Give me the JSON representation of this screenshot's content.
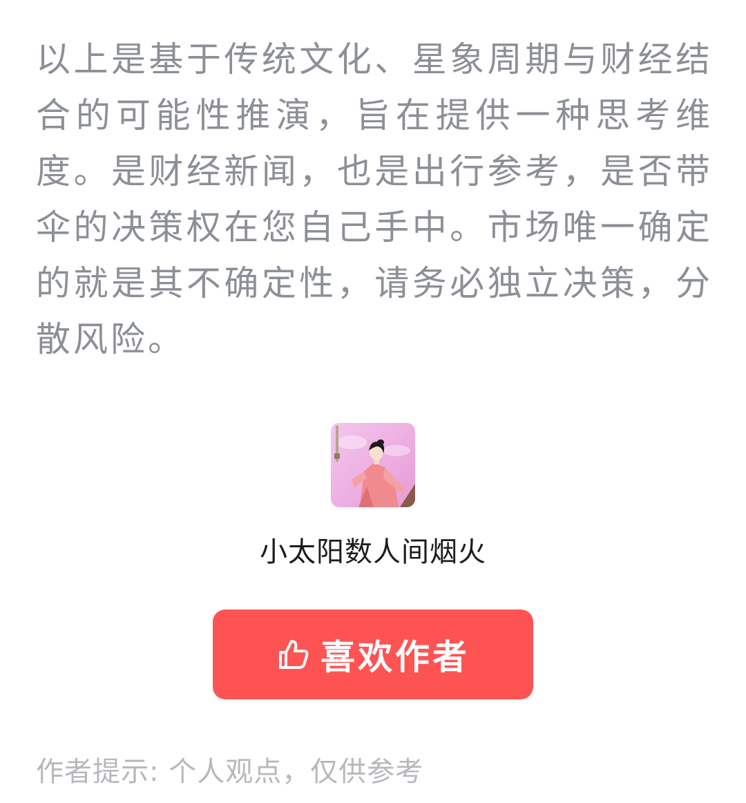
{
  "article": {
    "paragraph": "以上是基于传统文化、星象周期与财经结合的可能性推演，旨在提供一种思考维度。是财经新闻，也是出行参考，是否带伞的决策权在您自己手中。市场唯一确定的就是其不确定性，请务必独立决策，分散风险。"
  },
  "author": {
    "avatar_icon": "author-avatar-illustration",
    "name": "小太阳数人间烟火",
    "like_button_label": "喜欢作者",
    "like_icon": "thumbs-up-icon"
  },
  "footer": {
    "tip": "作者提示: 个人观点，仅供参考"
  },
  "colors": {
    "body_text": "#8c8f96",
    "accent_red": "#fd5353",
    "tip_text": "#b6b8bc"
  }
}
